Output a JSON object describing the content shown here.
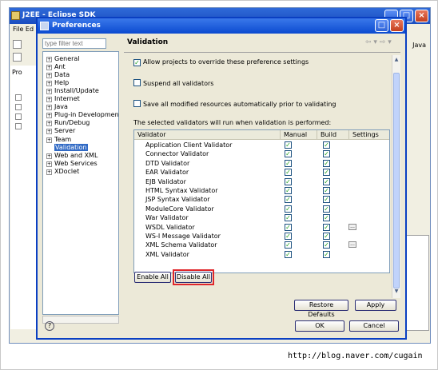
{
  "background_window": {
    "title": "J2EE - Eclipse SDK",
    "menu_text": "File  Ed",
    "left_tab": "Pro",
    "right_perspective": "Java"
  },
  "dialog": {
    "title": "Preferences",
    "filter_placeholder": "type filter text",
    "nav_items": [
      {
        "label": "General",
        "expandable": true
      },
      {
        "label": "Ant",
        "expandable": true
      },
      {
        "label": "Data",
        "expandable": true
      },
      {
        "label": "Help",
        "expandable": true
      },
      {
        "label": "Install/Update",
        "expandable": true
      },
      {
        "label": "Internet",
        "expandable": true
      },
      {
        "label": "Java",
        "expandable": true
      },
      {
        "label": "Plug-in Development",
        "expandable": true
      },
      {
        "label": "Run/Debug",
        "expandable": true
      },
      {
        "label": "Server",
        "expandable": true
      },
      {
        "label": "Team",
        "expandable": true
      },
      {
        "label": "Validation",
        "expandable": false,
        "selected": true
      },
      {
        "label": "Web and XML",
        "expandable": true
      },
      {
        "label": "Web Services",
        "expandable": true
      },
      {
        "label": "XDoclet",
        "expandable": true
      }
    ],
    "page_title": "Validation",
    "allow_override": {
      "label": "Allow projects to override these preference settings",
      "checked": true
    },
    "suspend_all": {
      "label": "Suspend all validators",
      "checked": false
    },
    "save_all": {
      "label": "Save all modified resources automatically prior to validating",
      "checked": false
    },
    "table_caption": "The selected validators will run when validation is performed:",
    "columns": [
      "Validator",
      "Manual",
      "Build",
      "Settings"
    ],
    "validators": [
      {
        "name": "Application Client Validator",
        "manual": true,
        "build": true,
        "settings": false
      },
      {
        "name": "Connector Validator",
        "manual": true,
        "build": true,
        "settings": false
      },
      {
        "name": "DTD Validator",
        "manual": true,
        "build": true,
        "settings": false
      },
      {
        "name": "EAR Validator",
        "manual": true,
        "build": true,
        "settings": false
      },
      {
        "name": "EJB Validator",
        "manual": true,
        "build": true,
        "settings": false
      },
      {
        "name": "HTML Syntax Validator",
        "manual": true,
        "build": true,
        "settings": false
      },
      {
        "name": "JSP Syntax Validator",
        "manual": true,
        "build": true,
        "settings": false
      },
      {
        "name": "ModuleCore Validator",
        "manual": true,
        "build": true,
        "settings": false
      },
      {
        "name": "War Validator",
        "manual": true,
        "build": true,
        "settings": false
      },
      {
        "name": "WSDL Validator",
        "manual": true,
        "build": true,
        "settings": true
      },
      {
        "name": "WS-I Message Validator",
        "manual": true,
        "build": true,
        "settings": false
      },
      {
        "name": "XML Schema Validator",
        "manual": true,
        "build": true,
        "settings": true
      },
      {
        "name": "XML Validator",
        "manual": true,
        "build": true,
        "settings": false
      }
    ],
    "enable_all_label": "Enable All",
    "disable_all_label": "Disable All",
    "restore_defaults_label": "Restore Defaults",
    "apply_label": "Apply",
    "ok_label": "OK",
    "cancel_label": "Cancel",
    "help_glyph": "?"
  },
  "watermark": "http://blog.naver.com/cugain",
  "colors": {
    "title_blue": "#0b4ad0",
    "selection": "#316ac5",
    "highlight_red": "#e0262b",
    "check_green": "#21a121"
  }
}
